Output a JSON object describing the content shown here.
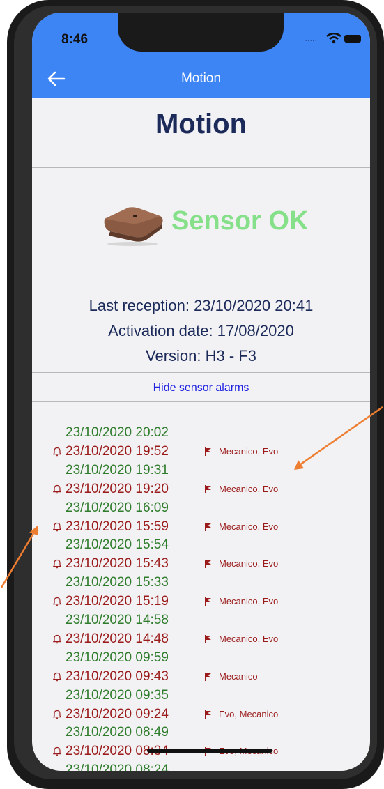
{
  "status_bar": {
    "time": "8:46",
    "signal": "....."
  },
  "nav": {
    "title": "Motion"
  },
  "page": {
    "title": "Motion"
  },
  "sensor": {
    "status": "Sensor OK",
    "last_reception": "Last reception: 23/10/2020 20:41",
    "activation_date": "Activation date: 17/08/2020",
    "version": "Version: H3 - F3"
  },
  "alarms_toggle": "Hide sensor alarms",
  "colors": {
    "nav_blue": "#3d84f5",
    "title_navy": "#1c2a5a",
    "ok_green": "#86e08a",
    "event_green": "#2f7d2c",
    "alarm_red": "#9b1b1b",
    "link_blue": "#1f22e0",
    "annotation_orange": "#ed7d31"
  },
  "events": [
    {
      "time": "23/10/2020 20:02",
      "type": "ok"
    },
    {
      "time": "23/10/2020 19:52",
      "type": "alarm",
      "sensors": "Mecanico, Evo"
    },
    {
      "time": "23/10/2020 19:31",
      "type": "ok"
    },
    {
      "time": "23/10/2020 19:20",
      "type": "alarm",
      "sensors": "Mecanico, Evo"
    },
    {
      "time": "23/10/2020 16:09",
      "type": "ok"
    },
    {
      "time": "23/10/2020 15:59",
      "type": "alarm",
      "sensors": "Mecanico, Evo"
    },
    {
      "time": "23/10/2020 15:54",
      "type": "ok"
    },
    {
      "time": "23/10/2020 15:43",
      "type": "alarm",
      "sensors": "Mecanico, Evo"
    },
    {
      "time": "23/10/2020 15:33",
      "type": "ok"
    },
    {
      "time": "23/10/2020 15:19",
      "type": "alarm",
      "sensors": "Mecanico, Evo"
    },
    {
      "time": "23/10/2020 14:58",
      "type": "ok"
    },
    {
      "time": "23/10/2020 14:48",
      "type": "alarm",
      "sensors": "Mecanico, Evo"
    },
    {
      "time": "23/10/2020 09:59",
      "type": "ok"
    },
    {
      "time": "23/10/2020 09:43",
      "type": "alarm",
      "sensors": "Mecanico"
    },
    {
      "time": "23/10/2020 09:35",
      "type": "ok"
    },
    {
      "time": "23/10/2020 09:24",
      "type": "alarm",
      "sensors": "Evo, Mecanico"
    },
    {
      "time": "23/10/2020 08:49",
      "type": "ok"
    },
    {
      "time": "23/10/2020 08:34",
      "type": "alarm",
      "sensors": "Evo, Mecanico"
    },
    {
      "time": "23/10/2020 08:24",
      "type": "ok"
    }
  ]
}
